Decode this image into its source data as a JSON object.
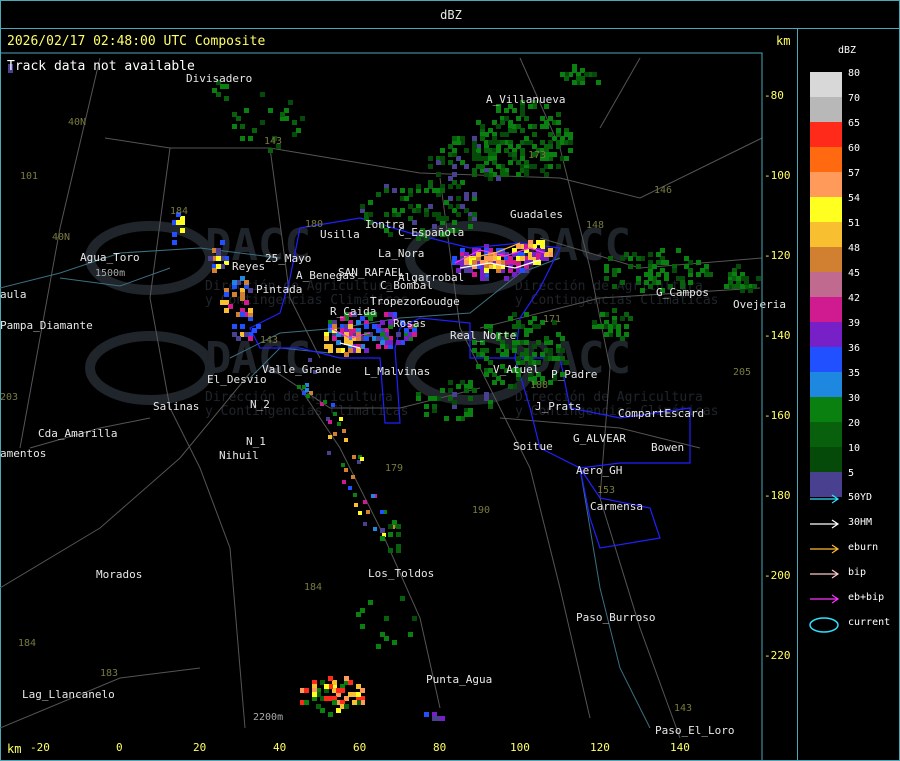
{
  "header": {
    "title": "dBZ",
    "timestamp_line": "2026/02/17 02:48:00 UTC Composite",
    "track_status": "Track data not available",
    "km_unit_top": "km",
    "km_unit_bottom": "km"
  },
  "axes": {
    "x_ticks": [
      "-20",
      "0",
      "20",
      "40",
      "60",
      "80",
      "100",
      "120",
      "140"
    ],
    "y_ticks": [
      "-80",
      "-100",
      "-120",
      "-140",
      "-160",
      "-180",
      "-200",
      "-220"
    ]
  },
  "map_labels": [
    {
      "id": "divisadero",
      "text": "Divisadero"
    },
    {
      "id": "a-villanueva",
      "text": "A_Villanueva"
    },
    {
      "id": "guadales",
      "text": "Guadales"
    },
    {
      "id": "iontra",
      "text": "Iontra"
    },
    {
      "id": "usilla",
      "text": "Usilla"
    },
    {
      "id": "c-espanola",
      "text": "C_Española"
    },
    {
      "id": "la-nora",
      "text": "La_Nora"
    },
    {
      "id": "agua-toro",
      "text": "Agua_Toro"
    },
    {
      "id": "elev-1500",
      "text": "1500m"
    },
    {
      "id": "aula",
      "text": "aula"
    },
    {
      "id": "pampa-diamante",
      "text": "Pampa_Diamante"
    },
    {
      "id": "reyes",
      "text": "Reyes"
    },
    {
      "id": "s-mayo",
      "text": "25_Mayo"
    },
    {
      "id": "a-benegas",
      "text": "A_Benegas"
    },
    {
      "id": "san-rafael",
      "text": "SAN_RAFAEL"
    },
    {
      "id": "algarrobal",
      "text": "Algarrobal"
    },
    {
      "id": "c-bombal",
      "text": "C_Bombal"
    },
    {
      "id": "pintada",
      "text": "Pintada"
    },
    {
      "id": "tropezon",
      "text": "Tropezon"
    },
    {
      "id": "goudge",
      "text": "Goudge"
    },
    {
      "id": "r-caida",
      "text": "R_Caida"
    },
    {
      "id": "rosas",
      "text": "Rosas"
    },
    {
      "id": "real-norte",
      "text": "Real_Norte"
    },
    {
      "id": "el-desvio",
      "text": "El_Desvio"
    },
    {
      "id": "valle-grande",
      "text": "Valle_Grande"
    },
    {
      "id": "l-malvinas",
      "text": "L_Malvinas"
    },
    {
      "id": "v-atuel",
      "text": "V_Atuel"
    },
    {
      "id": "p-padre",
      "text": "P_Padre"
    },
    {
      "id": "salinas",
      "text": "Salinas"
    },
    {
      "id": "n2",
      "text": "N_2"
    },
    {
      "id": "n1",
      "text": "N_1"
    },
    {
      "id": "nihuil",
      "text": "Nihuil"
    },
    {
      "id": "cda-amarilla",
      "text": "Cda_Amarilla"
    },
    {
      "id": "amentos",
      "text": "amentos"
    },
    {
      "id": "j-prats",
      "text": "J_Prats"
    },
    {
      "id": "compart-escard",
      "text": "CompartEscard"
    },
    {
      "id": "g-alvear",
      "text": "G_ALVEAR"
    },
    {
      "id": "soitue",
      "text": "Soitue"
    },
    {
      "id": "bowen",
      "text": "Bowen"
    },
    {
      "id": "aero-gh",
      "text": "Aero_GH"
    },
    {
      "id": "carmensa",
      "text": "Carmensa"
    },
    {
      "id": "g-campos",
      "text": "G_Campos"
    },
    {
      "id": "ovejeria",
      "text": "Ovejeria"
    },
    {
      "id": "morados",
      "text": "Morados"
    },
    {
      "id": "los-toldos",
      "text": "Los_Toldos"
    },
    {
      "id": "paso-burroso",
      "text": "Paso_Burroso"
    },
    {
      "id": "punta-agua",
      "text": "Punta_Agua"
    },
    {
      "id": "lag-llancanelo",
      "text": "Lag_Llancanelo"
    },
    {
      "id": "paso-el-loro",
      "text": "Paso_El_Loro"
    },
    {
      "id": "elev-2200",
      "text": "2200m"
    }
  ],
  "route_labels": [
    "40N",
    "101",
    "40N",
    "143",
    "184",
    "180",
    "173",
    "146",
    "148",
    "143",
    "188",
    "179",
    "190",
    "153",
    "203",
    "205",
    "184",
    "183",
    "184",
    "171",
    "143"
  ],
  "watermark": {
    "brand": "DACC",
    "line1": "Dirección de Agricultura",
    "line2": "y Contingencias Climáticas"
  },
  "legend": {
    "title": "dBZ",
    "levels": [
      {
        "value": "80",
        "color": "#d8d8d8"
      },
      {
        "value": "70",
        "color": "#b8b8b8"
      },
      {
        "value": "65",
        "color": "#ff2a1a"
      },
      {
        "value": "60",
        "color": "#ff6a10"
      },
      {
        "value": "57",
        "color": "#ff9a5a"
      },
      {
        "value": "54",
        "color": "#ffff20"
      },
      {
        "value": "51",
        "color": "#f8c030"
      },
      {
        "value": "48",
        "color": "#d08030"
      },
      {
        "value": "45",
        "color": "#c06a90"
      },
      {
        "value": "42",
        "color": "#d01a90"
      },
      {
        "value": "39",
        "color": "#7820c8"
      },
      {
        "value": "36",
        "color": "#2050ff"
      },
      {
        "value": "35",
        "color": "#1e88e0"
      },
      {
        "value": "30",
        "color": "#0a8010"
      },
      {
        "value": "20",
        "color": "#08600c"
      },
      {
        "value": "10",
        "color": "#064a0a"
      },
      {
        "value": "5",
        "color": "#4a4090"
      }
    ],
    "tracks": [
      {
        "label": "50YD",
        "color": "#30e0ff"
      },
      {
        "label": "30HM",
        "color": "#ffffff"
      },
      {
        "label": "eburn",
        "color": "#ffb830"
      },
      {
        "label": "bip",
        "color": "#ffc8c8"
      },
      {
        "label": "eb+bip",
        "color": "#ff30ff"
      },
      {
        "label": "current",
        "color": "#30e0ff"
      }
    ]
  }
}
